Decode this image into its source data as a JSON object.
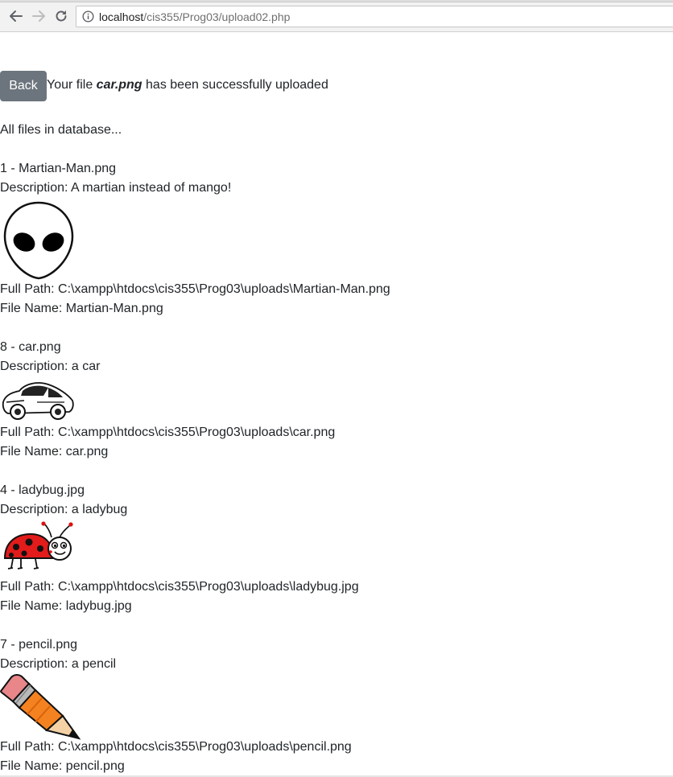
{
  "browser": {
    "url_host": "localhost",
    "url_path": "/cis355/Prog03/upload02.php",
    "icons": [
      "back-arrow-icon",
      "forward-arrow-icon",
      "reload-icon",
      "info-icon"
    ]
  },
  "page": {
    "back_label": "Back",
    "message_prefix": "Your file ",
    "uploaded_file": "car.png",
    "message_suffix": " has been successfully uploaded",
    "list_heading": "All files in database...",
    "files": [
      {
        "title": "1 - Martian-Man.png",
        "description": "Description: A martian instead of mango!",
        "image": "alien-head-image",
        "full_path": "Full Path: C:\\xampp\\htdocs\\cis355\\Prog03\\uploads\\Martian-Man.png",
        "file_name": "File Name: Martian-Man.png"
      },
      {
        "title": "8 - car.png",
        "description": "Description: a car",
        "image": "car-image",
        "full_path": "Full Path: C:\\xampp\\htdocs\\cis355\\Prog03\\uploads\\car.png",
        "file_name": "File Name: car.png"
      },
      {
        "title": "4 - ladybug.jpg",
        "description": "Description: a ladybug",
        "image": "ladybug-image",
        "full_path": "Full Path: C:\\xampp\\htdocs\\cis355\\Prog03\\uploads\\ladybug.jpg",
        "file_name": "File Name: ladybug.jpg"
      },
      {
        "title": "7 - pencil.png",
        "description": "Description: a pencil",
        "image": "pencil-image",
        "full_path": "Full Path: C:\\xampp\\htdocs\\cis355\\Prog03\\uploads\\pencil.png",
        "file_name": "File Name: pencil.png"
      }
    ]
  },
  "colors": {
    "back_button": "#6c757d",
    "text": "#212529"
  }
}
